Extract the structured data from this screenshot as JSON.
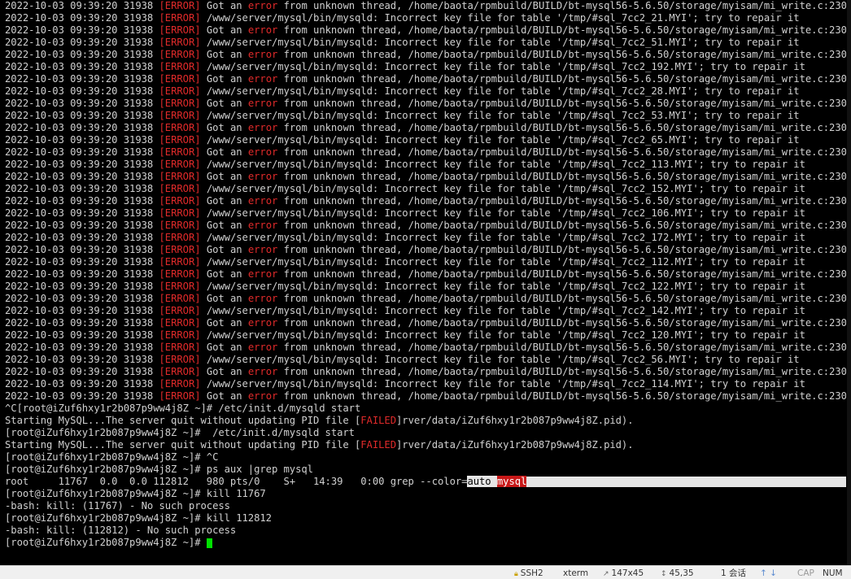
{
  "terminal": {
    "error_log": [
      {
        "ts": "2022-10-03 09:39:20 31938",
        "tag": "[ERROR]",
        "kind": "thread",
        "pre": "Got an",
        "word": "error",
        "post": "from unknown thread, /home/baota/rpmbuild/BUILD/bt-mysql56-5.6.50/storage/myisam/mi_write.c:230"
      },
      {
        "ts": "2022-10-03 09:39:20 31938",
        "tag": "[ERROR]",
        "kind": "key",
        "text": "/www/server/mysql/bin/mysqld: Incorrect key file for table '/tmp/#sql_7cc2_21.MYI'; try to repair it"
      },
      {
        "ts": "2022-10-03 09:39:20 31938",
        "tag": "[ERROR]",
        "kind": "thread",
        "pre": "Got an",
        "word": "error",
        "post": "from unknown thread, /home/baota/rpmbuild/BUILD/bt-mysql56-5.6.50/storage/myisam/mi_write.c:230"
      },
      {
        "ts": "2022-10-03 09:39:20 31938",
        "tag": "[ERROR]",
        "kind": "key",
        "text": "/www/server/mysql/bin/mysqld: Incorrect key file for table '/tmp/#sql_7cc2_51.MYI'; try to repair it"
      },
      {
        "ts": "2022-10-03 09:39:20 31938",
        "tag": "[ERROR]",
        "kind": "thread",
        "pre": "Got an",
        "word": "error",
        "post": "from unknown thread, /home/baota/rpmbuild/BUILD/bt-mysql56-5.6.50/storage/myisam/mi_write.c:230"
      },
      {
        "ts": "2022-10-03 09:39:20 31938",
        "tag": "[ERROR]",
        "kind": "key",
        "text": "/www/server/mysql/bin/mysqld: Incorrect key file for table '/tmp/#sql_7cc2_192.MYI'; try to repair it"
      },
      {
        "ts": "2022-10-03 09:39:20 31938",
        "tag": "[ERROR]",
        "kind": "thread",
        "pre": "Got an",
        "word": "error",
        "post": "from unknown thread, /home/baota/rpmbuild/BUILD/bt-mysql56-5.6.50/storage/myisam/mi_write.c:230"
      },
      {
        "ts": "2022-10-03 09:39:20 31938",
        "tag": "[ERROR]",
        "kind": "key",
        "text": "/www/server/mysql/bin/mysqld: Incorrect key file for table '/tmp/#sql_7cc2_28.MYI'; try to repair it"
      },
      {
        "ts": "2022-10-03 09:39:20 31938",
        "tag": "[ERROR]",
        "kind": "thread",
        "pre": "Got an",
        "word": "error",
        "post": "from unknown thread, /home/baota/rpmbuild/BUILD/bt-mysql56-5.6.50/storage/myisam/mi_write.c:230"
      },
      {
        "ts": "2022-10-03 09:39:20 31938",
        "tag": "[ERROR]",
        "kind": "key",
        "text": "/www/server/mysql/bin/mysqld: Incorrect key file for table '/tmp/#sql_7cc2_53.MYI'; try to repair it"
      },
      {
        "ts": "2022-10-03 09:39:20 31938",
        "tag": "[ERROR]",
        "kind": "thread",
        "pre": "Got an",
        "word": "error",
        "post": "from unknown thread, /home/baota/rpmbuild/BUILD/bt-mysql56-5.6.50/storage/myisam/mi_write.c:230"
      },
      {
        "ts": "2022-10-03 09:39:20 31938",
        "tag": "[ERROR]",
        "kind": "key",
        "text": "/www/server/mysql/bin/mysqld: Incorrect key file for table '/tmp/#sql_7cc2_65.MYI'; try to repair it"
      },
      {
        "ts": "2022-10-03 09:39:20 31938",
        "tag": "[ERROR]",
        "kind": "thread",
        "pre": "Got an",
        "word": "error",
        "post": "from unknown thread, /home/baota/rpmbuild/BUILD/bt-mysql56-5.6.50/storage/myisam/mi_write.c:230"
      },
      {
        "ts": "2022-10-03 09:39:20 31938",
        "tag": "[ERROR]",
        "kind": "key",
        "text": "/www/server/mysql/bin/mysqld: Incorrect key file for table '/tmp/#sql_7cc2_113.MYI'; try to repair it"
      },
      {
        "ts": "2022-10-03 09:39:20 31938",
        "tag": "[ERROR]",
        "kind": "thread",
        "pre": "Got an",
        "word": "error",
        "post": "from unknown thread, /home/baota/rpmbuild/BUILD/bt-mysql56-5.6.50/storage/myisam/mi_write.c:230"
      },
      {
        "ts": "2022-10-03 09:39:20 31938",
        "tag": "[ERROR]",
        "kind": "key",
        "text": "/www/server/mysql/bin/mysqld: Incorrect key file for table '/tmp/#sql_7cc2_152.MYI'; try to repair it"
      },
      {
        "ts": "2022-10-03 09:39:20 31938",
        "tag": "[ERROR]",
        "kind": "thread",
        "pre": "Got an",
        "word": "error",
        "post": "from unknown thread, /home/baota/rpmbuild/BUILD/bt-mysql56-5.6.50/storage/myisam/mi_write.c:230"
      },
      {
        "ts": "2022-10-03 09:39:20 31938",
        "tag": "[ERROR]",
        "kind": "key",
        "text": "/www/server/mysql/bin/mysqld: Incorrect key file for table '/tmp/#sql_7cc2_106.MYI'; try to repair it"
      },
      {
        "ts": "2022-10-03 09:39:20 31938",
        "tag": "[ERROR]",
        "kind": "thread",
        "pre": "Got an",
        "word": "error",
        "post": "from unknown thread, /home/baota/rpmbuild/BUILD/bt-mysql56-5.6.50/storage/myisam/mi_write.c:230"
      },
      {
        "ts": "2022-10-03 09:39:20 31938",
        "tag": "[ERROR]",
        "kind": "key",
        "text": "/www/server/mysql/bin/mysqld: Incorrect key file for table '/tmp/#sql_7cc2_172.MYI'; try to repair it"
      },
      {
        "ts": "2022-10-03 09:39:20 31938",
        "tag": "[ERROR]",
        "kind": "thread",
        "pre": "Got an",
        "word": "error",
        "post": "from unknown thread, /home/baota/rpmbuild/BUILD/bt-mysql56-5.6.50/storage/myisam/mi_write.c:230"
      },
      {
        "ts": "2022-10-03 09:39:20 31938",
        "tag": "[ERROR]",
        "kind": "key",
        "text": "/www/server/mysql/bin/mysqld: Incorrect key file for table '/tmp/#sql_7cc2_112.MYI'; try to repair it"
      },
      {
        "ts": "2022-10-03 09:39:20 31938",
        "tag": "[ERROR]",
        "kind": "thread",
        "pre": "Got an",
        "word": "error",
        "post": "from unknown thread, /home/baota/rpmbuild/BUILD/bt-mysql56-5.6.50/storage/myisam/mi_write.c:230"
      },
      {
        "ts": "2022-10-03 09:39:20 31938",
        "tag": "[ERROR]",
        "kind": "key",
        "text": "/www/server/mysql/bin/mysqld: Incorrect key file for table '/tmp/#sql_7cc2_122.MYI'; try to repair it"
      },
      {
        "ts": "2022-10-03 09:39:20 31938",
        "tag": "[ERROR]",
        "kind": "thread",
        "pre": "Got an",
        "word": "error",
        "post": "from unknown thread, /home/baota/rpmbuild/BUILD/bt-mysql56-5.6.50/storage/myisam/mi_write.c:230"
      },
      {
        "ts": "2022-10-03 09:39:20 31938",
        "tag": "[ERROR]",
        "kind": "key",
        "text": "/www/server/mysql/bin/mysqld: Incorrect key file for table '/tmp/#sql_7cc2_142.MYI'; try to repair it"
      },
      {
        "ts": "2022-10-03 09:39:20 31938",
        "tag": "[ERROR]",
        "kind": "thread",
        "pre": "Got an",
        "word": "error",
        "post": "from unknown thread, /home/baota/rpmbuild/BUILD/bt-mysql56-5.6.50/storage/myisam/mi_write.c:230"
      },
      {
        "ts": "2022-10-03 09:39:20 31938",
        "tag": "[ERROR]",
        "kind": "key",
        "text": "/www/server/mysql/bin/mysqld: Incorrect key file for table '/tmp/#sql_7cc2_120.MYI'; try to repair it"
      },
      {
        "ts": "2022-10-03 09:39:20 31938",
        "tag": "[ERROR]",
        "kind": "thread",
        "pre": "Got an",
        "word": "error",
        "post": "from unknown thread, /home/baota/rpmbuild/BUILD/bt-mysql56-5.6.50/storage/myisam/mi_write.c:230"
      },
      {
        "ts": "2022-10-03 09:39:20 31938",
        "tag": "[ERROR]",
        "kind": "key",
        "text": "/www/server/mysql/bin/mysqld: Incorrect key file for table '/tmp/#sql_7cc2_56.MYI'; try to repair it"
      },
      {
        "ts": "2022-10-03 09:39:20 31938",
        "tag": "[ERROR]",
        "kind": "thread",
        "pre": "Got an",
        "word": "error",
        "post": "from unknown thread, /home/baota/rpmbuild/BUILD/bt-mysql56-5.6.50/storage/myisam/mi_write.c:230"
      },
      {
        "ts": "2022-10-03 09:39:20 31938",
        "tag": "[ERROR]",
        "kind": "key",
        "text": "/www/server/mysql/bin/mysqld: Incorrect key file for table '/tmp/#sql_7cc2_114.MYI'; try to repair it"
      },
      {
        "ts": "2022-10-03 09:39:20 31938",
        "tag": "[ERROR]",
        "kind": "thread",
        "pre": "Got an",
        "word": "error",
        "post": "from unknown thread, /home/baota/rpmbuild/BUILD/bt-mysql56-5.6.50/storage/myisam/mi_write.c:230"
      }
    ],
    "session": {
      "cmd1": "^C[root@iZuf6hxy1r2b087p9ww4j8Z ~]# /etc/init.d/mysqld start",
      "start_pre": "Starting MySQL...The server quit without updating PID file [",
      "failed": "FAILED",
      "start_post": "]rver/data/iZuf6hxy1r2b087p9ww4j8Z.pid).",
      "cmd2": "[root@iZuf6hxy1r2b087p9ww4j8Z ~]#  /etc/init.d/mysqld start",
      "start2_pre": "Starting MySQL...The server quit without updating PID file [",
      "failed2": "FAILED",
      "start2_post": "]rver/data/iZuf6hxy1r2b087p9ww4j8Z.pid).",
      "cmd3": "[root@iZuf6hxy1r2b087p9ww4j8Z ~]# ^C",
      "cmd4": "[root@iZuf6hxy1r2b087p9ww4j8Z ~]# ps aux |grep mysql",
      "ps_pre": "root     11767  0.0  0.0 112812   980 pts/0    S+   14:39   0:00 grep --color=",
      "ps_auto": "auto ",
      "ps_mysql": "mysql",
      "cmd5": "[root@iZuf6hxy1r2b087p9ww4j8Z ~]# kill 11767",
      "kill1_out": "-bash: kill: (11767) - No such process",
      "cmd6": "[root@iZuf6hxy1r2b087p9ww4j8Z ~]# kill 112812",
      "kill2_out": "-bash: kill: (112812) - No such process",
      "prompt": "[root@iZuf6hxy1r2b087p9ww4j8Z ~]# "
    }
  },
  "statusbar": {
    "protocol": "SSH2",
    "term_type": "xterm",
    "size": "147x45",
    "cursor_pos": "45,35",
    "sessions": "1 会话",
    "caps": "CAP",
    "num": "NUM"
  },
  "colors": {
    "background": "#000000",
    "text": "#d0d0d0",
    "error": "#e02a2a",
    "cursor": "#00e000"
  }
}
